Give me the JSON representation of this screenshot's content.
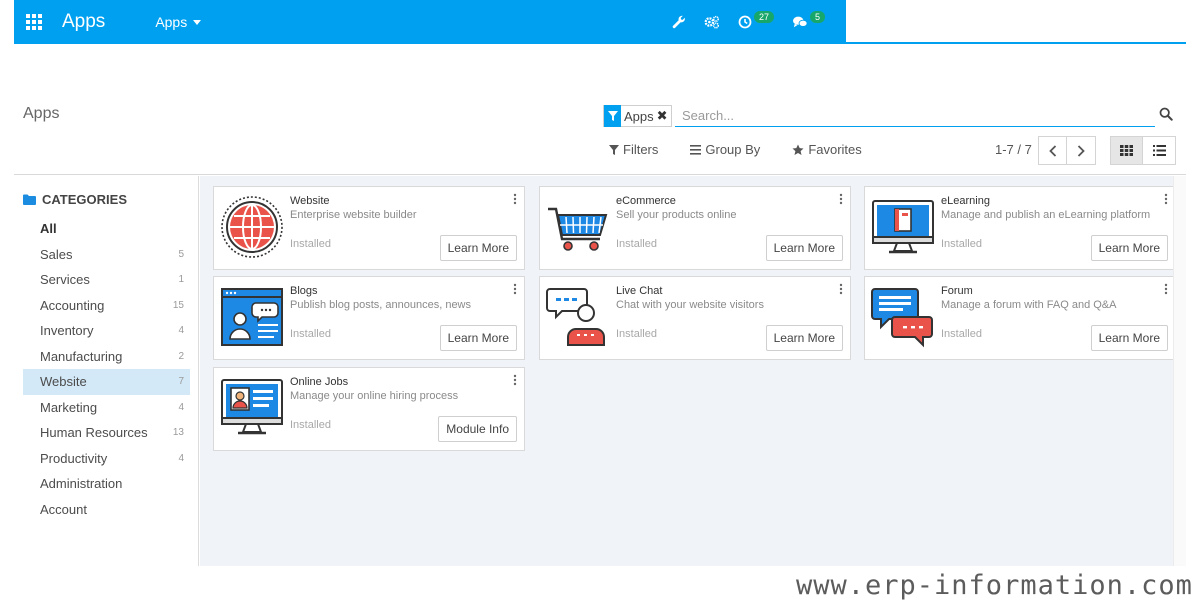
{
  "navbar": {
    "brand": "Apps",
    "menu_label": "Apps",
    "activity_count": "27",
    "messages_count": "5",
    "icons": [
      "app-grid-icon",
      "wrench-icon",
      "users-cog-icon",
      "clock-icon",
      "chat-icon"
    ]
  },
  "control_panel": {
    "breadcrumb": "Apps",
    "facet_label": "Apps",
    "search_placeholder": "Search...",
    "filters_label": "Filters",
    "group_by_label": "Group By",
    "favorites_label": "Favorites",
    "pager": "1-7 / 7"
  },
  "sidebar": {
    "header": "CATEGORIES",
    "items": [
      {
        "label": "All",
        "count": ""
      },
      {
        "label": "Sales",
        "count": "5"
      },
      {
        "label": "Services",
        "count": "1"
      },
      {
        "label": "Accounting",
        "count": "15"
      },
      {
        "label": "Inventory",
        "count": "4"
      },
      {
        "label": "Manufacturing",
        "count": "2"
      },
      {
        "label": "Website",
        "count": "7"
      },
      {
        "label": "Marketing",
        "count": "4"
      },
      {
        "label": "Human Resources",
        "count": "13"
      },
      {
        "label": "Productivity",
        "count": "4"
      },
      {
        "label": "Administration",
        "count": ""
      },
      {
        "label": "Account",
        "count": ""
      }
    ]
  },
  "apps": [
    {
      "name": "Website",
      "summary": "Enterprise website builder",
      "status": "Installed",
      "action": "Learn More",
      "icon": "globe-icon"
    },
    {
      "name": "eCommerce",
      "summary": "Sell your products online",
      "status": "Installed",
      "action": "Learn More",
      "icon": "shopping-cart-icon"
    },
    {
      "name": "eLearning",
      "summary": "Manage and publish an eLearning platform",
      "status": "Installed",
      "action": "Learn More",
      "icon": "monitor-book-icon"
    },
    {
      "name": "Blogs",
      "summary": "Publish blog posts, announces, news",
      "status": "Installed",
      "action": "Learn More",
      "icon": "blog-page-icon"
    },
    {
      "name": "Live Chat",
      "summary": "Chat with your website visitors",
      "status": "Installed",
      "action": "Learn More",
      "icon": "live-chat-icon"
    },
    {
      "name": "Forum",
      "summary": "Manage a forum with FAQ and Q&A",
      "status": "Installed",
      "action": "Learn More",
      "icon": "forum-bubbles-icon"
    },
    {
      "name": "Online Jobs",
      "summary": "Manage your online hiring process",
      "status": "Installed",
      "action": "Module Info",
      "icon": "job-profile-icon"
    }
  ],
  "watermark": "www.erp-information.com",
  "colors": {
    "navbar": "#00a0f0",
    "badge": "#17a76a",
    "active_category": "#d3e9f8",
    "kanban_bg": "#f0f4f9"
  }
}
